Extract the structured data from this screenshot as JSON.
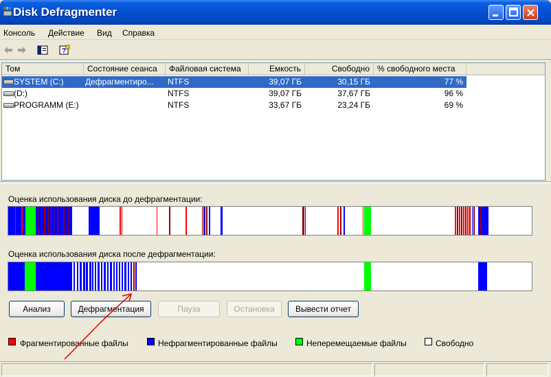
{
  "window": {
    "title": "Disk Defragmenter",
    "title_bar_color": "#0553d6"
  },
  "menu": [
    "Консоль",
    "Действие",
    "Вид",
    "Справка"
  ],
  "toolbar_icons": [
    "back-arrow-icon",
    "forward-arrow-icon",
    "show-hide-console-tree-icon",
    "help-icon"
  ],
  "volumes": {
    "columns": [
      "Том",
      "Состояние сеанса",
      "Файловая система",
      "Емкость",
      "Свободно",
      "% свободного места"
    ],
    "rows": [
      {
        "volume": "SYSTEM (C:)",
        "status": "Дефрагментиро...",
        "fs": "NTFS",
        "capacity": "39,07 ГБ",
        "free": "30,15 ГБ",
        "percent": "77 %",
        "selected": true
      },
      {
        "volume": "(D:)",
        "status": "",
        "fs": "NTFS",
        "capacity": "39,07 ГБ",
        "free": "37,67 ГБ",
        "percent": "96 %",
        "selected": false
      },
      {
        "volume": "PROGRAMM (E:)",
        "status": "",
        "fs": "NTFS",
        "capacity": "33,67 ГБ",
        "free": "23,24 ГБ",
        "percent": "69 %",
        "selected": false
      }
    ]
  },
  "before_label": "Оценка использования диска до дефрагментации:",
  "after_label": "Оценка использования диска после дефрагментации:",
  "buttons": {
    "analyze": "Анализ",
    "defragment": "Дефрагментация",
    "pause": "Пауза",
    "stop": "Остановка",
    "report": "Вывести отчет"
  },
  "legend": [
    {
      "label": "Фрагментированные файлы",
      "color": "#ff0000"
    },
    {
      "label": "Нефрагментированные файлы",
      "color": "#0000ff"
    },
    {
      "label": "Неперемещаемые файлы",
      "color": "#00ff00"
    },
    {
      "label": "Свободно",
      "color": "#ffffff"
    }
  ],
  "colors": {
    "fragmented": "#ff0000",
    "contiguous": "#0000ff",
    "unmovable": "#00ff00",
    "free": "#ffffff",
    "dark_red": "#990000",
    "selection": "#316ac5",
    "annotation": "#e00000"
  }
}
